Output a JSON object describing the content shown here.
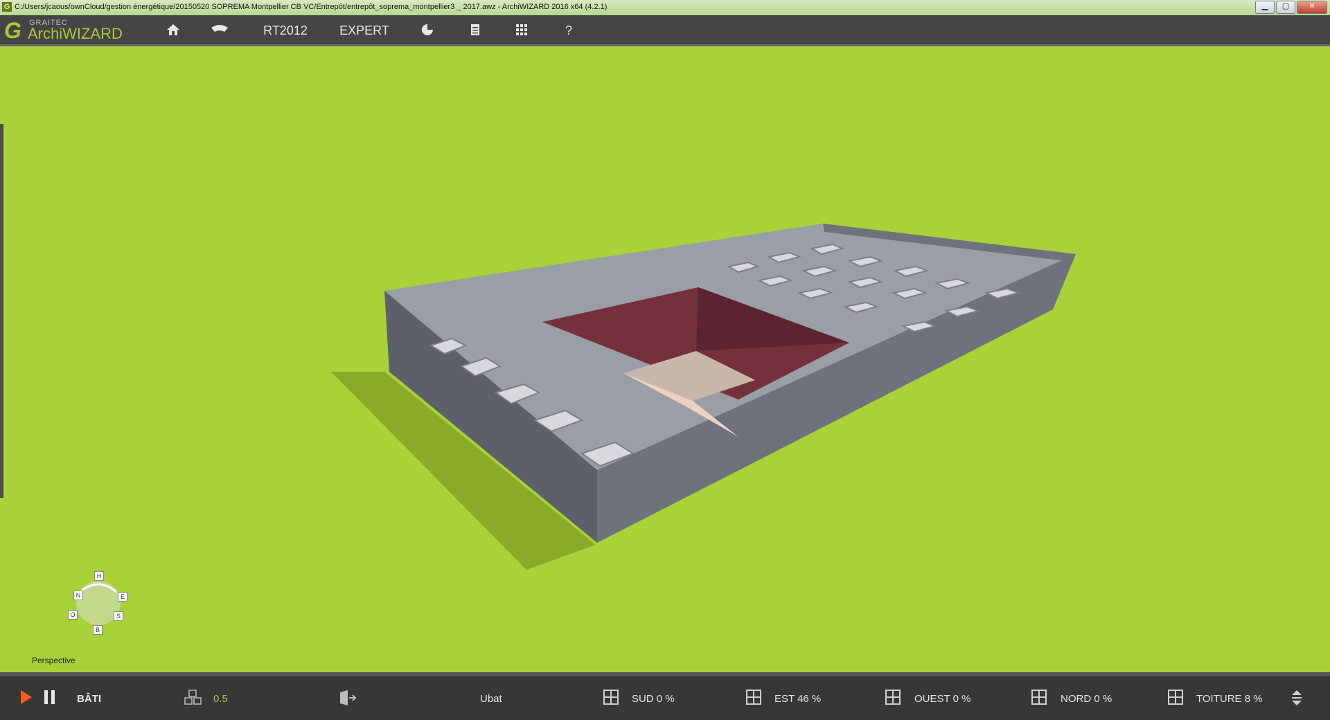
{
  "window": {
    "title": "C:/Users/jcaous/ownCloud/gestion énergétique/20150520 SOPREMA Montpellier CB VC/Entrepôt/entrepôt_soprema_montpellier3 _ 2017.awz  -  ArchiWIZARD 2016 x64 (4.2.1)",
    "minimize": "▁",
    "maximize": "▢",
    "close": "✕"
  },
  "logo": {
    "company": "GRAITEC",
    "product": "ArchiWIZARD",
    "icon": "graitec-g-logo"
  },
  "menu": {
    "items": [
      {
        "label": "",
        "icon": "home-icon"
      },
      {
        "label": "",
        "icon": "eye-icon"
      },
      {
        "label": "RT2012",
        "icon": ""
      },
      {
        "label": "EXPERT",
        "icon": ""
      },
      {
        "label": "",
        "icon": "pie-chart-icon"
      },
      {
        "label": "",
        "icon": "document-icon"
      },
      {
        "label": "",
        "icon": "grid-icon"
      },
      {
        "label": "?",
        "icon": ""
      }
    ]
  },
  "viewport": {
    "view_mode": "Perspective",
    "compass": {
      "top": "H",
      "north": "N",
      "east": "E",
      "west": "O",
      "south": "S",
      "bottom": "B"
    },
    "colors": {
      "ground": "#a9d138",
      "building_top": "#9a9ea6",
      "building_side": "#5d5f6b",
      "courtyard": "#74313c"
    }
  },
  "statusbar": {
    "mode_label": "BÂTI",
    "scale_value": "0.5",
    "ubat_label": "Ubat",
    "orientations": [
      {
        "label": "SUD 0 %"
      },
      {
        "label": "EST 46 %"
      },
      {
        "label": "OUEST 0 %"
      },
      {
        "label": "NORD 0 %"
      },
      {
        "label": "TOITURE 8 %"
      }
    ],
    "colors": {
      "play": "#ff5a1f",
      "accent": "#a6c93a"
    }
  }
}
